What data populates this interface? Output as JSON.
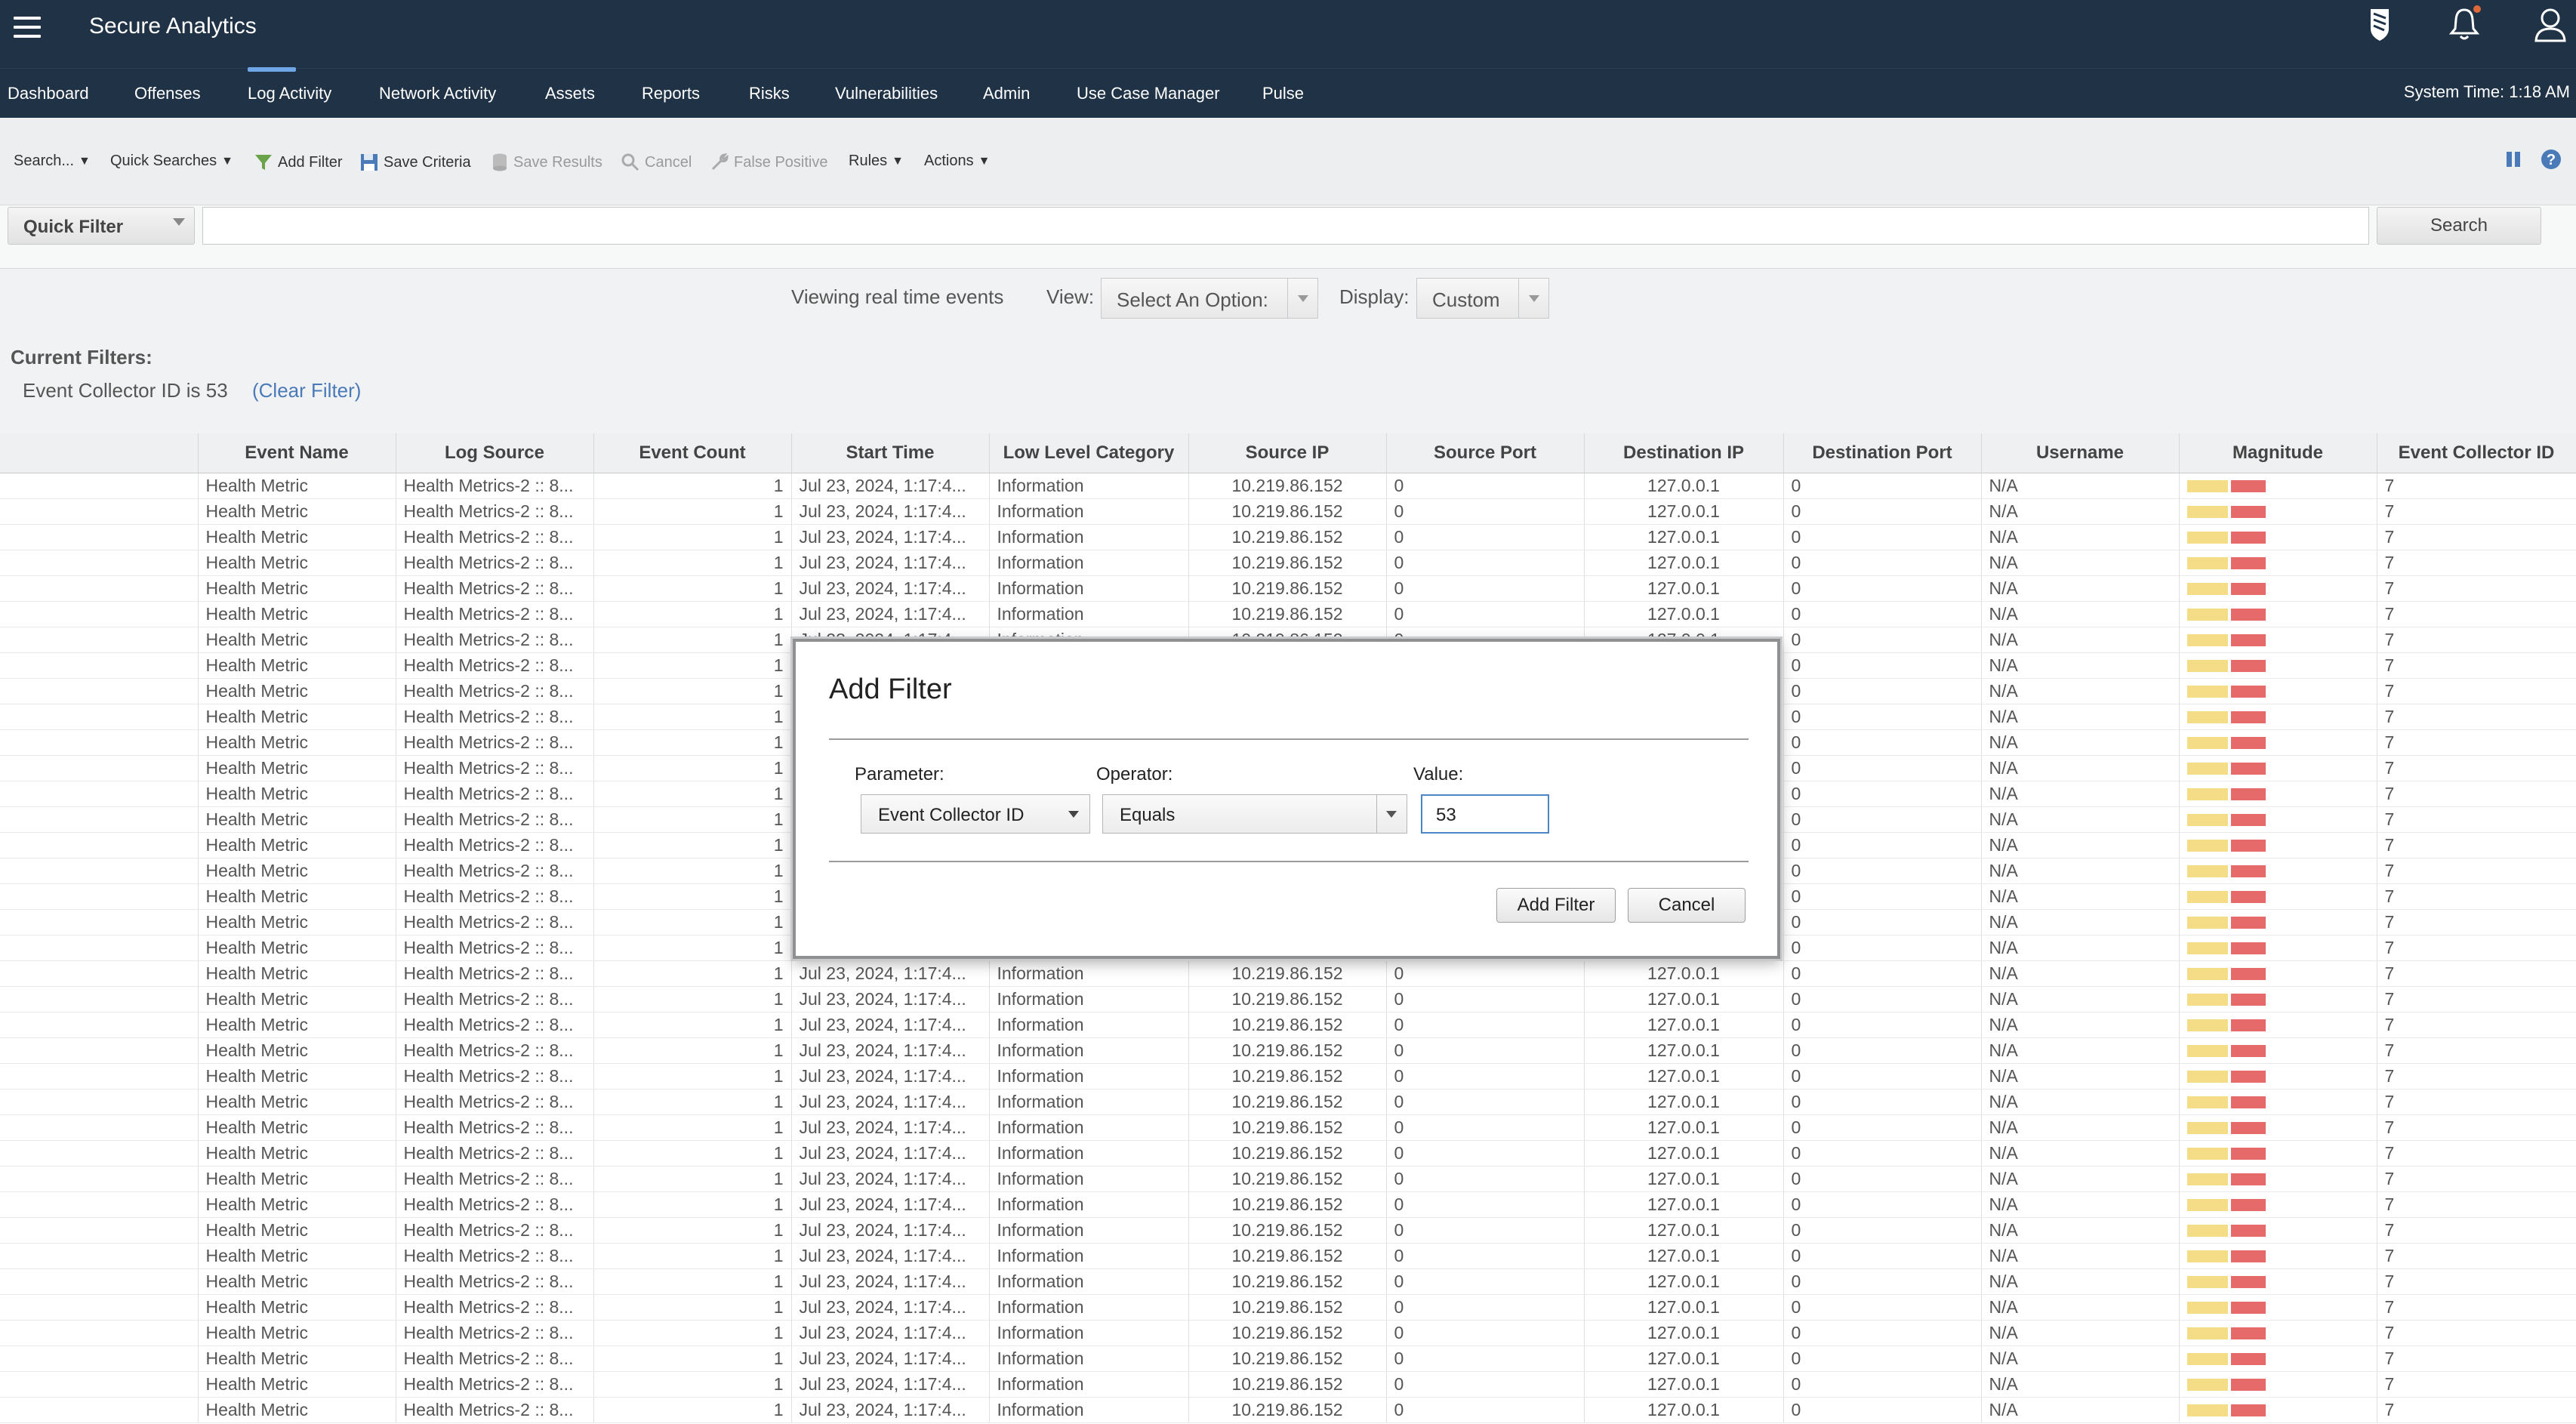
{
  "header": {
    "app_title": "Secure Analytics",
    "icons": [
      "menu-icon",
      "shield-icon",
      "bell-icon",
      "user-icon"
    ]
  },
  "nav": {
    "items": [
      "Dashboard",
      "Offenses",
      "Log Activity",
      "Network Activity",
      "Assets",
      "Reports",
      "Risks",
      "Vulnerabilities",
      "Admin",
      "Use Case Manager",
      "Pulse"
    ],
    "active": "Log Activity",
    "system_time": "System Time: 1:18 AM"
  },
  "toolbar": {
    "search": "Search...",
    "quick_searches": "Quick Searches",
    "add_filter": "Add Filter",
    "save_criteria": "Save Criteria",
    "save_results": "Save Results",
    "cancel": "Cancel",
    "false_positive": "False Positive",
    "rules": "Rules",
    "actions": "Actions"
  },
  "quick_filter": {
    "select_label": "Quick Filter",
    "input_value": "",
    "search_button": "Search"
  },
  "view": {
    "viewing_text": "Viewing real time events",
    "view_label": "View:",
    "view_value": "Select An Option:",
    "display_label": "Display:",
    "display_value": "Custom"
  },
  "current_filters": {
    "title": "Current Filters:",
    "filter_text": "Event Collector ID is 53",
    "clear_link": "(Clear Filter)"
  },
  "table": {
    "columns": [
      "",
      "Event Name",
      "Log Source",
      "Event Count",
      "Start Time",
      "Low Level Category",
      "Source IP",
      "Source Port",
      "Destination IP",
      "Destination Port",
      "Username",
      "Magnitude",
      "Event Collector ID"
    ],
    "row_template": {
      "event_name": "Health Metric",
      "log_source": "Health Metrics-2 :: 8...",
      "event_count": "1",
      "start_time": "Jul 23, 2024, 1:17:4...",
      "low_level_category": "Information",
      "source_ip": "10.219.86.152",
      "source_port": "0",
      "destination_ip": "127.0.0.1",
      "destination_port": "0",
      "username": "N/A",
      "event_collector_id": "7"
    },
    "row_count": 37
  },
  "modal": {
    "title": "Add Filter",
    "parameter_label": "Parameter:",
    "parameter_value": "Event Collector ID",
    "operator_label": "Operator:",
    "operator_value": "Equals",
    "value_label": "Value:",
    "value_input": "53",
    "add_button": "Add Filter",
    "cancel_button": "Cancel"
  },
  "colors": {
    "header_bg": "#1f3246",
    "accent": "#6fa6e6",
    "link": "#4a7ab8",
    "magnitude_low": "#f5dc86",
    "magnitude_high": "#e66a6a",
    "notification_dot": "#e0673a"
  }
}
